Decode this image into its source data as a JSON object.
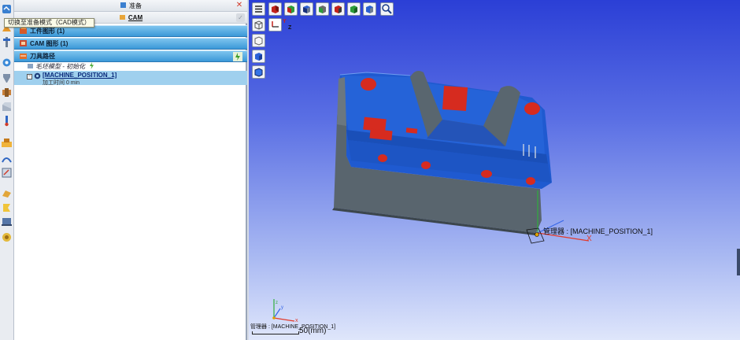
{
  "mode_tabs": {
    "prep": {
      "label": "准备"
    },
    "cam": {
      "label": "CAM"
    },
    "close_glyph": "✕",
    "check_glyph": "✓"
  },
  "tooltip": {
    "text": "切换至准备模式（CAD模式）"
  },
  "sections": {
    "workpiece": {
      "label": "工件图形 (1)"
    },
    "cam_shape": {
      "label": "CAM 图形 (1)"
    },
    "toolpath": {
      "label": "刀具路径"
    }
  },
  "tree": {
    "stock": {
      "label": "毛坯模型 - 初始化"
    },
    "machine_position": {
      "label": "[MACHINE_POSITION_1]",
      "sub": "加工时间 0 min",
      "expand_glyph": "−"
    }
  },
  "viewport": {
    "machine_label": "管理器 : [MACHINE_POSITION_1]",
    "bottom_label": "管理器 : [MACHINE_POSITION_1]",
    "scale_label": "50(mm)",
    "axis_x": "X",
    "axis_x_small": "x",
    "axis_y_small": "y",
    "axis_z_small": "z",
    "axis_corner_y": "Y",
    "axis_corner_z": "Z"
  },
  "icons": {
    "left_toolbar": [
      "prep-mode-icon",
      "shape-icon",
      "tool-icon",
      "cam-wizard-icon",
      "drill-icon",
      "holder-icon",
      "stock-icon",
      "probe-icon",
      "machine-icon",
      "path-edit-icon",
      "transform-icon",
      "simulate-icon",
      "report-icon",
      "post-icon",
      "verify-icon",
      "export-icon",
      "setting-icon"
    ],
    "view_toolbar": [
      "menu-icon",
      "view-front-icon",
      "view-back-icon",
      "view-top-icon",
      "view-bottom-icon",
      "view-left-icon",
      "view-right-icon",
      "view-iso-icon",
      "zoom-fit-icon"
    ]
  },
  "colors": {
    "part_blue": "#1a56c8",
    "part_gray": "#5f6b73",
    "part_red": "#d62b1f",
    "section_blue": "#3b98d8",
    "viewport_top": "#2b3fd6",
    "viewport_bottom": "#dfe6fb"
  }
}
